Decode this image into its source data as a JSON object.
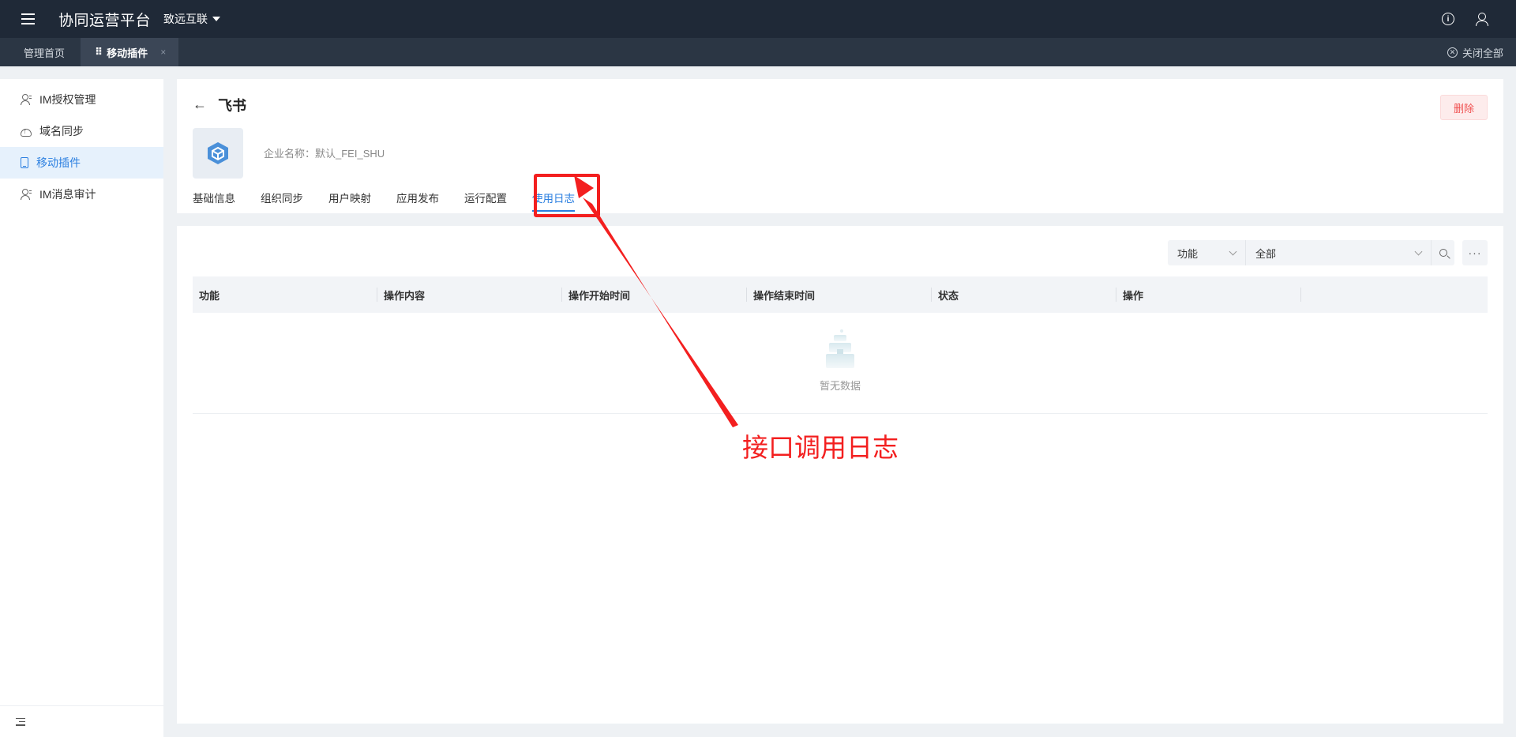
{
  "topbar": {
    "app_title": "协同运营平台",
    "org": "致远互联"
  },
  "tabs": {
    "home": "管理首页",
    "active_dots": "⠿",
    "active": "移动插件",
    "close_glyph": "×",
    "close_all": "关闭全部"
  },
  "sidebar": {
    "items": [
      {
        "label": "IM授权管理",
        "icon": "users-icon"
      },
      {
        "label": "域名同步",
        "icon": "cloud-upload-icon"
      },
      {
        "label": "移动插件",
        "icon": "phone-icon"
      },
      {
        "label": "IM消息审计",
        "icon": "users-icon"
      }
    ]
  },
  "detail": {
    "back": "←",
    "title": "飞书",
    "company_label": "企业名称：",
    "company_value": "默认_FEI_SHU",
    "delete_label": "删除",
    "subtabs": [
      "基础信息",
      "组织同步",
      "用户映射",
      "应用发布",
      "运行配置",
      "使用日志"
    ]
  },
  "filter": {
    "field": "功能",
    "value": "全部",
    "more": "···"
  },
  "table": {
    "columns": [
      "功能",
      "操作内容",
      "操作开始时间",
      "操作结束时间",
      "状态",
      "操作",
      ""
    ],
    "empty_text": "暂无数据"
  },
  "annotation": {
    "text": "接口调用日志",
    "color": "#f31f1f"
  },
  "colors": {
    "accent": "#2b7fe0",
    "topbar": "#1f2937",
    "danger": "#f05050"
  }
}
